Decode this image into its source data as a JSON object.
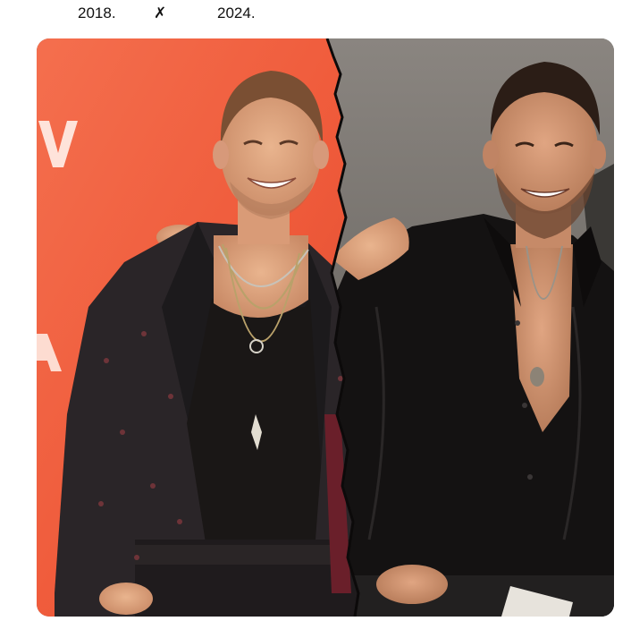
{
  "post": {
    "caption": {
      "year_left": "2018.",
      "separator": "✗",
      "year_right": "2024."
    },
    "media": {
      "description_icon": "photo-collage",
      "left_background_color": "#f0623f",
      "right_background_color": "#77736e"
    }
  }
}
